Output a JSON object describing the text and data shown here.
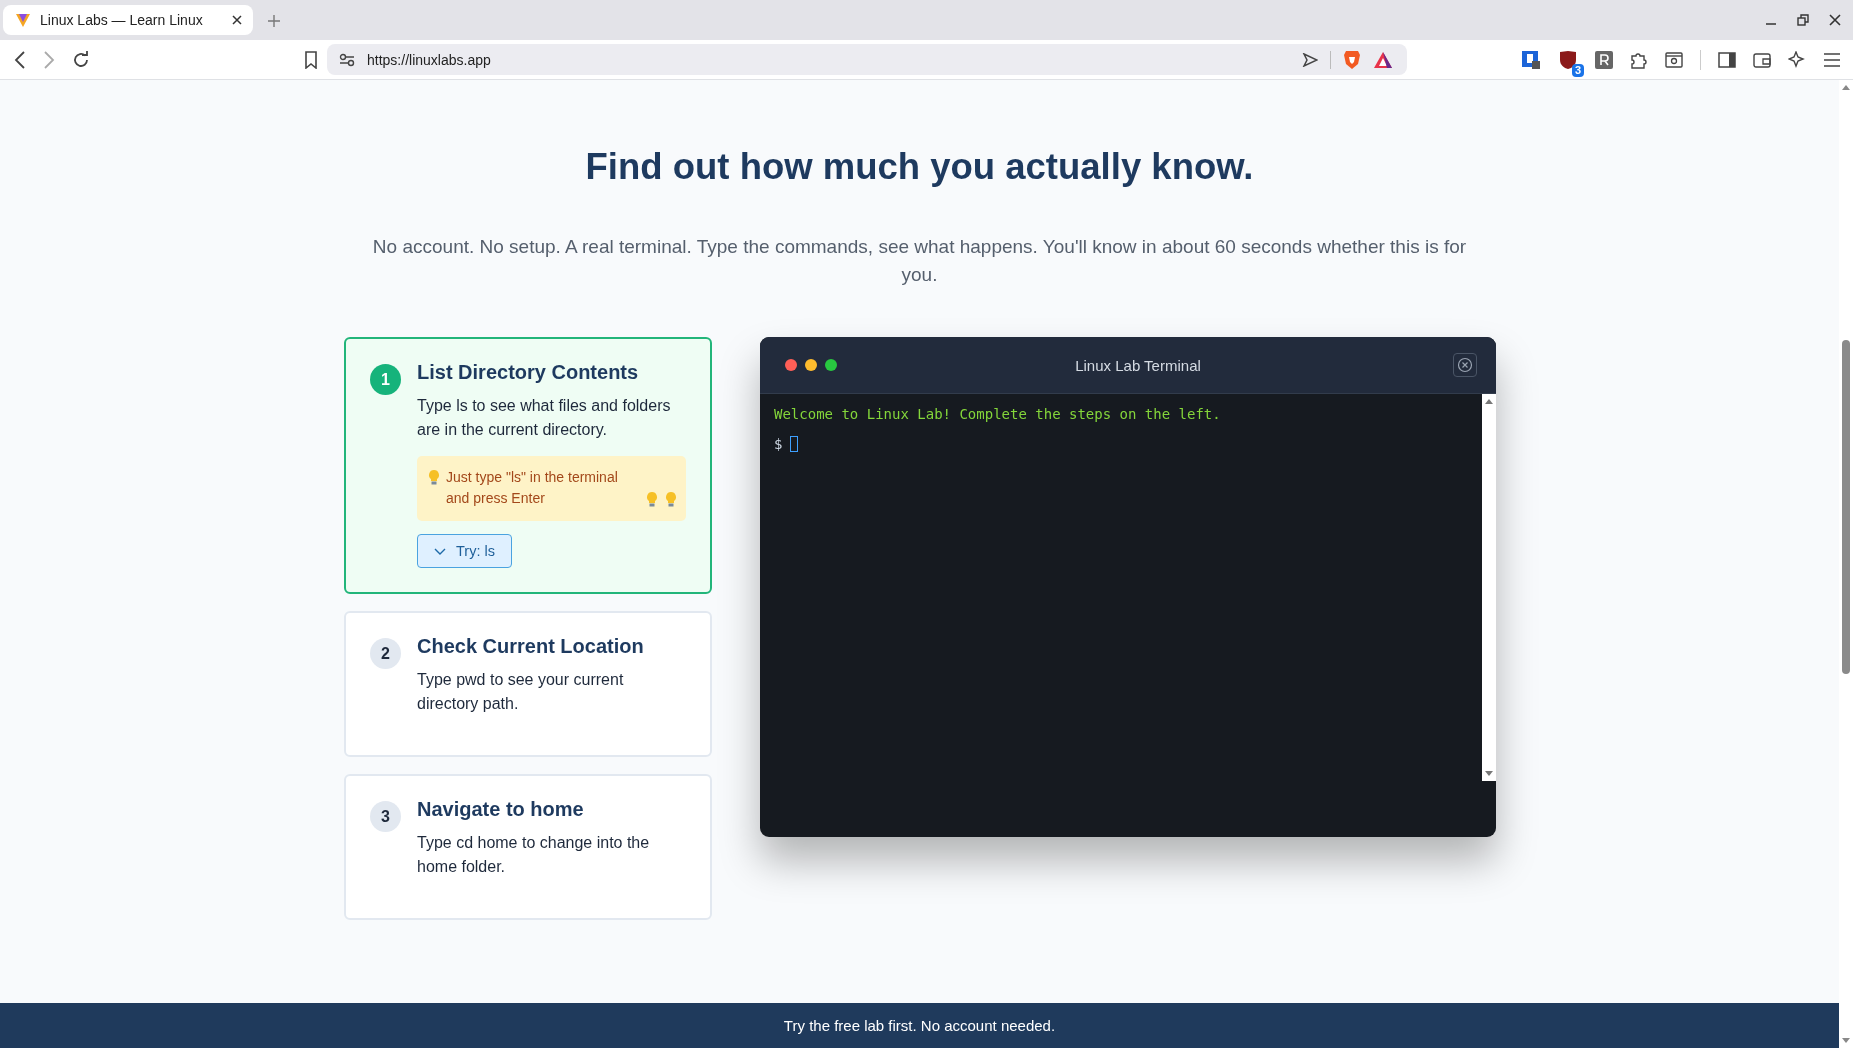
{
  "browser": {
    "tabs": [
      {
        "title": "Linux Labs — Learn Linux",
        "selected": true
      }
    ],
    "url": "https://linuxlabs.app",
    "extension_badge": "3"
  },
  "heading": "Find out how much you actually know.",
  "subtitle": "No account. No setup. A real terminal. Type the commands, see what happens. You'll know in about 60 seconds whether this is for you.",
  "steps": [
    {
      "number": "1",
      "title": "List Directory Contents",
      "description": "Type ls to see what files and folders are in the current directory.",
      "active": true,
      "hint": "Just type \"ls\" in the terminal and press Enter",
      "try_label": "Try: ls"
    },
    {
      "number": "2",
      "title": "Check Current Location",
      "description": "Type pwd to see your current directory path.",
      "active": false
    },
    {
      "number": "3",
      "title": "Navigate to home",
      "description": "Type cd home to change into the home folder.",
      "active": false
    }
  ],
  "terminal": {
    "title": "Linux Lab Terminal",
    "lines": [
      {
        "kind": "output",
        "text": "Welcome to Linux Lab! Complete the steps on the left."
      }
    ],
    "prompt": "$"
  },
  "footer": "Try the free lab first. No account needed."
}
